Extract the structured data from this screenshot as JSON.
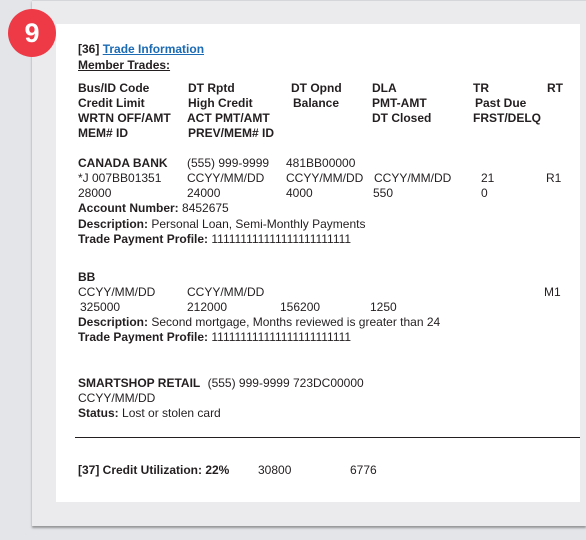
{
  "badge": {
    "number": "9",
    "color": "#ee3a47"
  },
  "section36": {
    "index": "[36]",
    "title": "Trade Information",
    "subtitle": "Member Trades:"
  },
  "headers": {
    "row1": [
      "Bus/ID Code",
      "DT Rptd",
      "DT Opnd",
      "DLA",
      "TR",
      "RT"
    ],
    "row2": [
      "Credit Limit",
      "High Credit",
      "Balance",
      "PMT-AMT",
      "Past Due"
    ],
    "row3": [
      "WRTN OFF/AMT",
      "ACT PMT/AMT",
      "DT Closed",
      "FRST/DELQ"
    ],
    "row4": [
      "MEM# ID",
      "PREV/MEM# ID"
    ]
  },
  "trades": [
    {
      "name": "CANADA BANK",
      "phone": "(555) 999-9999",
      "code": "481BB00000",
      "row2": [
        "*J 007BB01351",
        "CCYY/MM/DD",
        "CCYY/MM/DD",
        "CCYY/MM/DD",
        "21",
        "R1"
      ],
      "row3": [
        "28000",
        "24000",
        "4000",
        "550",
        "0"
      ],
      "account_label": "Account Number:",
      "account_value": "8452675",
      "description_label": "Description:",
      "description_value": "Personal Loan, Semi-Monthly Payments",
      "profile_label": "Trade Payment Profile:",
      "profile_value": "111111111111111111111111"
    },
    {
      "name": "BB",
      "row2": [
        "CCYY/MM/DD",
        "CCYY/MM/DD",
        "M1"
      ],
      "row3": [
        "325000",
        "212000",
        "156200",
        "1250"
      ],
      "description_label": "Description:",
      "description_value": "Second mortgage, Months reviewed is greater than 24",
      "profile_label": "Trade Payment Profile:",
      "profile_value": "111111111111111111111111"
    },
    {
      "name": "SMARTSHOP RETAIL",
      "phone_code": "(555) 999-9999 723DC00000",
      "date": "CCYY/MM/DD",
      "status_label": "Status:",
      "status_value": "Lost or stolen card"
    }
  ],
  "section37": {
    "label": "[37] Credit Utilization: 22%",
    "value1": "30800",
    "value2": "6776"
  }
}
